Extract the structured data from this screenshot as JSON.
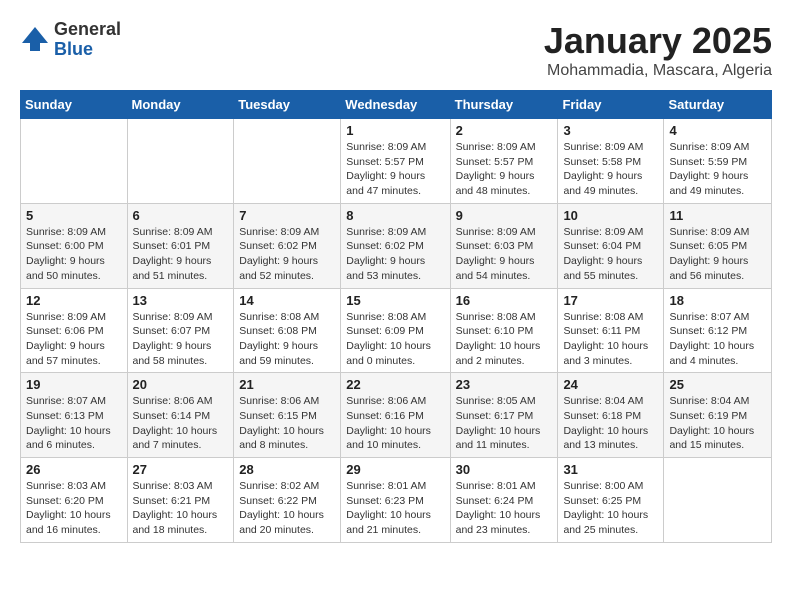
{
  "header": {
    "logo_general": "General",
    "logo_blue": "Blue",
    "title": "January 2025",
    "location": "Mohammadia, Mascara, Algeria"
  },
  "weekdays": [
    "Sunday",
    "Monday",
    "Tuesday",
    "Wednesday",
    "Thursday",
    "Friday",
    "Saturday"
  ],
  "weeks": [
    [
      {
        "day": "",
        "info": ""
      },
      {
        "day": "",
        "info": ""
      },
      {
        "day": "",
        "info": ""
      },
      {
        "day": "1",
        "info": "Sunrise: 8:09 AM\nSunset: 5:57 PM\nDaylight: 9 hours\nand 47 minutes."
      },
      {
        "day": "2",
        "info": "Sunrise: 8:09 AM\nSunset: 5:57 PM\nDaylight: 9 hours\nand 48 minutes."
      },
      {
        "day": "3",
        "info": "Sunrise: 8:09 AM\nSunset: 5:58 PM\nDaylight: 9 hours\nand 49 minutes."
      },
      {
        "day": "4",
        "info": "Sunrise: 8:09 AM\nSunset: 5:59 PM\nDaylight: 9 hours\nand 49 minutes."
      }
    ],
    [
      {
        "day": "5",
        "info": "Sunrise: 8:09 AM\nSunset: 6:00 PM\nDaylight: 9 hours\nand 50 minutes."
      },
      {
        "day": "6",
        "info": "Sunrise: 8:09 AM\nSunset: 6:01 PM\nDaylight: 9 hours\nand 51 minutes."
      },
      {
        "day": "7",
        "info": "Sunrise: 8:09 AM\nSunset: 6:02 PM\nDaylight: 9 hours\nand 52 minutes."
      },
      {
        "day": "8",
        "info": "Sunrise: 8:09 AM\nSunset: 6:02 PM\nDaylight: 9 hours\nand 53 minutes."
      },
      {
        "day": "9",
        "info": "Sunrise: 8:09 AM\nSunset: 6:03 PM\nDaylight: 9 hours\nand 54 minutes."
      },
      {
        "day": "10",
        "info": "Sunrise: 8:09 AM\nSunset: 6:04 PM\nDaylight: 9 hours\nand 55 minutes."
      },
      {
        "day": "11",
        "info": "Sunrise: 8:09 AM\nSunset: 6:05 PM\nDaylight: 9 hours\nand 56 minutes."
      }
    ],
    [
      {
        "day": "12",
        "info": "Sunrise: 8:09 AM\nSunset: 6:06 PM\nDaylight: 9 hours\nand 57 minutes."
      },
      {
        "day": "13",
        "info": "Sunrise: 8:09 AM\nSunset: 6:07 PM\nDaylight: 9 hours\nand 58 minutes."
      },
      {
        "day": "14",
        "info": "Sunrise: 8:08 AM\nSunset: 6:08 PM\nDaylight: 9 hours\nand 59 minutes."
      },
      {
        "day": "15",
        "info": "Sunrise: 8:08 AM\nSunset: 6:09 PM\nDaylight: 10 hours\nand 0 minutes."
      },
      {
        "day": "16",
        "info": "Sunrise: 8:08 AM\nSunset: 6:10 PM\nDaylight: 10 hours\nand 2 minutes."
      },
      {
        "day": "17",
        "info": "Sunrise: 8:08 AM\nSunset: 6:11 PM\nDaylight: 10 hours\nand 3 minutes."
      },
      {
        "day": "18",
        "info": "Sunrise: 8:07 AM\nSunset: 6:12 PM\nDaylight: 10 hours\nand 4 minutes."
      }
    ],
    [
      {
        "day": "19",
        "info": "Sunrise: 8:07 AM\nSunset: 6:13 PM\nDaylight: 10 hours\nand 6 minutes."
      },
      {
        "day": "20",
        "info": "Sunrise: 8:06 AM\nSunset: 6:14 PM\nDaylight: 10 hours\nand 7 minutes."
      },
      {
        "day": "21",
        "info": "Sunrise: 8:06 AM\nSunset: 6:15 PM\nDaylight: 10 hours\nand 8 minutes."
      },
      {
        "day": "22",
        "info": "Sunrise: 8:06 AM\nSunset: 6:16 PM\nDaylight: 10 hours\nand 10 minutes."
      },
      {
        "day": "23",
        "info": "Sunrise: 8:05 AM\nSunset: 6:17 PM\nDaylight: 10 hours\nand 11 minutes."
      },
      {
        "day": "24",
        "info": "Sunrise: 8:04 AM\nSunset: 6:18 PM\nDaylight: 10 hours\nand 13 minutes."
      },
      {
        "day": "25",
        "info": "Sunrise: 8:04 AM\nSunset: 6:19 PM\nDaylight: 10 hours\nand 15 minutes."
      }
    ],
    [
      {
        "day": "26",
        "info": "Sunrise: 8:03 AM\nSunset: 6:20 PM\nDaylight: 10 hours\nand 16 minutes."
      },
      {
        "day": "27",
        "info": "Sunrise: 8:03 AM\nSunset: 6:21 PM\nDaylight: 10 hours\nand 18 minutes."
      },
      {
        "day": "28",
        "info": "Sunrise: 8:02 AM\nSunset: 6:22 PM\nDaylight: 10 hours\nand 20 minutes."
      },
      {
        "day": "29",
        "info": "Sunrise: 8:01 AM\nSunset: 6:23 PM\nDaylight: 10 hours\nand 21 minutes."
      },
      {
        "day": "30",
        "info": "Sunrise: 8:01 AM\nSunset: 6:24 PM\nDaylight: 10 hours\nand 23 minutes."
      },
      {
        "day": "31",
        "info": "Sunrise: 8:00 AM\nSunset: 6:25 PM\nDaylight: 10 hours\nand 25 minutes."
      },
      {
        "day": "",
        "info": ""
      }
    ]
  ]
}
